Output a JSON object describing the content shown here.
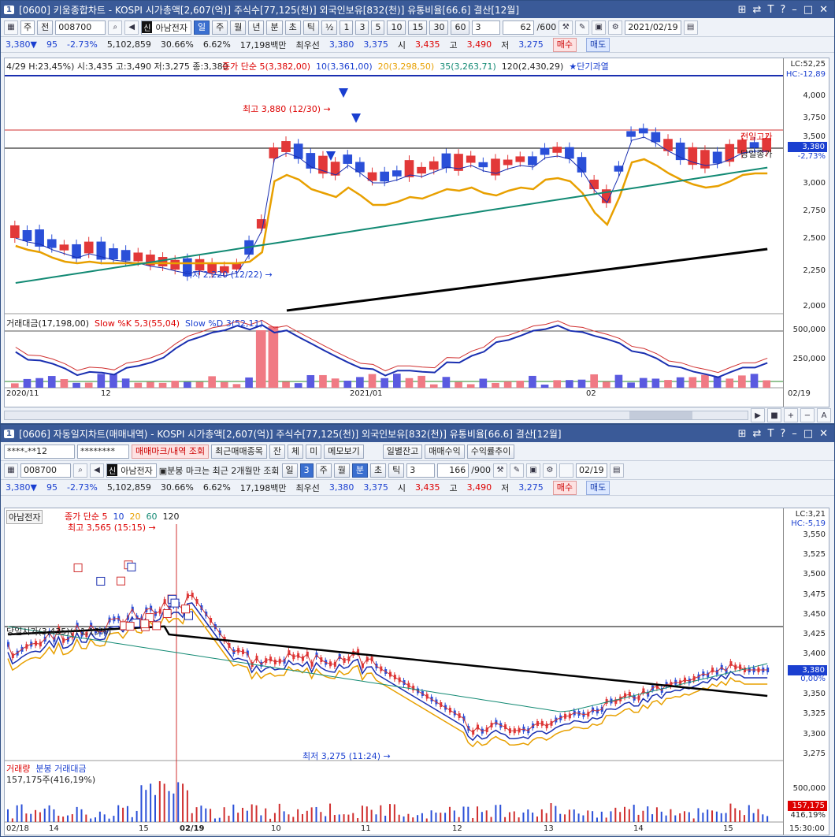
{
  "win1": {
    "num": "1",
    "title": "[0600] 키움종합차트 - KOSPI 시가총액[2,607(억)] 주식수[77,125(천)] 외국인보유[832(천)] 유통비율[66.6] 결산[12월]",
    "toolbar": {
      "type_sel": "주",
      "prev": "전",
      "code": "008700",
      "name": "아남전자",
      "periods": [
        "일",
        "주",
        "월",
        "년",
        "분",
        "초",
        "틱"
      ],
      "half": "½",
      "mins": [
        "1",
        "3",
        "5",
        "10",
        "15",
        "30",
        "60"
      ],
      "sel_num": "3",
      "count": "62",
      "total": "/600",
      "date": "2021/02/19"
    },
    "quote": {
      "price": "3,380",
      "arrow": "▼",
      "change": "95",
      "pct": "-2.73%",
      "volume": "5,102,859",
      "turnover": "30.66%",
      "pct2": "6.62%",
      "amount": "17,198백만",
      "best_label": "최우선",
      "best1": "3,380",
      "best2": "3,375",
      "open_label": "시",
      "open": "3,435",
      "high_label": "고",
      "high": "3,490",
      "low_label": "저",
      "low": "3,275",
      "buy": "매수",
      "sell": "매도"
    },
    "legend_top": "4/29 H:23,45%) 시:3,435 고:3,490 저:3,275 종:3,380",
    "ma_legend": {
      "close": "종가 단순 5(3,382,00)",
      "ma10": "10(3,361,00)",
      "ma20": "20(3,298,50)",
      "ma35": "35(3,263,71)",
      "ma120": "120(2,430,29)",
      "star": "★단기과열"
    },
    "lc": "LC:52,25",
    "hc": "HC:-12,89",
    "high_note": "최고 3,880 (12/30) →",
    "low_note": "최저 2,220 (12/22) →",
    "prev_high": "전일고가",
    "today_close": "당일종가",
    "last_price": "3,380",
    "last_pct": "-2,73%",
    "y_ticks": [
      "4,000",
      "3,750",
      "3,500",
      "3,250",
      "3,000",
      "2,750",
      "2,500",
      "2,250",
      "2,000"
    ],
    "sub_legend": {
      "a": "거래대금(17,198,00)",
      "b": "Slow %K 5,3(55,04)",
      "c": "Slow %D 3(52,11)"
    },
    "sub_ticks": [
      "500,000",
      "250,000"
    ],
    "x_labels": [
      "2020/11",
      "12",
      "2021/01",
      "02",
      "02/19"
    ]
  },
  "win2": {
    "num": "1",
    "title": "[0606] 자동일지차트(매매내역) - KOSPI 시가총액[2,607(억)] 주식수[77,125(천)] 외국인보유[832(천)] 유통비율[66.6] 결산[12월]",
    "row1": {
      "acct": "****-**12",
      "pw": "********",
      "b1": "매매마크/내역 조회",
      "b2": "최근매매종목",
      "b3": "잔",
      "b4": "체",
      "b5": "미",
      "b6": "메모보기",
      "b7": "일별잔고",
      "b8": "매매수익",
      "b9": "수익률추이"
    },
    "toolbar": {
      "code": "008700",
      "name": "아남전자",
      "note": "분봉 마크는 최근 2개월만 조회",
      "periods": [
        "일",
        "3",
        "주",
        "월",
        "분",
        "초",
        "틱"
      ],
      "sel_num": "3",
      "count": "166",
      "total": "/900",
      "date": "02/19"
    },
    "quote": {
      "price": "3,380",
      "arrow": "▼",
      "change": "95",
      "pct": "-2.73%",
      "volume": "5,102,859",
      "turnover": "30.66%",
      "pct2": "6.62%",
      "amount": "17,198백만",
      "best_label": "최우선",
      "best1": "3,380",
      "best2": "3,375",
      "open_label": "시",
      "open": "3,435",
      "high_label": "고",
      "high": "3,490",
      "low_label": "저",
      "low": "3,275",
      "buy": "매수",
      "sell": "매도"
    },
    "stock_tag": "아남전자",
    "ma_legend": {
      "close": "종가 단순 5",
      "m10": "10",
      "m20": "20",
      "m60": "60",
      "m120": "120"
    },
    "high_note": "최고 3,565 (15:15) →",
    "low_note": "최저 3,275 (11:24) →",
    "open_note": "당일시가(3,435)(+1,15%)",
    "lc": "LC:3,21",
    "hc": "HC:-5,19",
    "last_price": "3,380",
    "last_pct": "0,00%",
    "y_ticks": [
      "3,550",
      "3,525",
      "3,500",
      "3,475",
      "3,450",
      "3,425",
      "3,400",
      "3,375",
      "3,350",
      "3,325",
      "3,300",
      "3,275"
    ],
    "sub_legend": {
      "a": "거래량",
      "b": "분봉 거래대금",
      "c": "157,175주(416,19%)"
    },
    "sub_ticks": [
      "500,000"
    ],
    "vol_box": "157,175",
    "vol_pct": "416,19%",
    "x_labels": [
      "02/18",
      "14",
      "15",
      "02/19",
      "10",
      "11",
      "12",
      "13",
      "14",
      "15",
      "15:30:00"
    ]
  }
}
